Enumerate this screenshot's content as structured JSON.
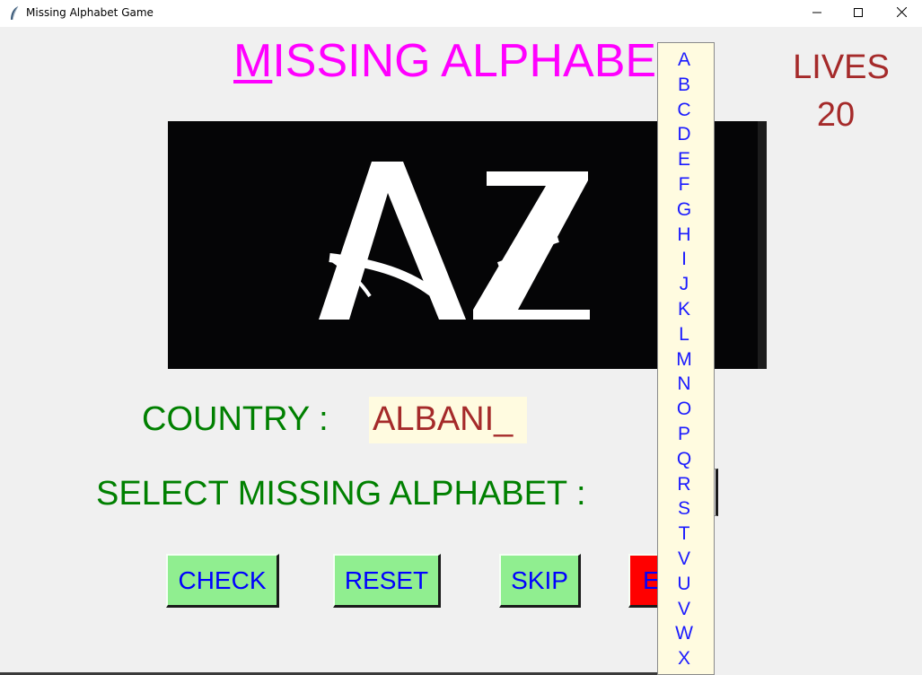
{
  "window": {
    "title": "Missing Alphabet Game"
  },
  "heading": {
    "first_letter": "M",
    "rest": "ISSING ALPHABE"
  },
  "lives": {
    "label": "LIVES",
    "value": "20"
  },
  "picture": {
    "text": "AZ"
  },
  "country": {
    "label": "COUNTRY :",
    "value": "ALBANI_"
  },
  "select": {
    "label": "SELECT MISSING ALPHABET :"
  },
  "buttons": {
    "check": "CHECK",
    "reset": "RESET",
    "skip": "SKIP",
    "exit": "E"
  },
  "dropdown": {
    "options": [
      "A",
      "B",
      "C",
      "D",
      "E",
      "F",
      "G",
      "H",
      "I",
      "J",
      "K",
      "L",
      "M",
      "N",
      "O",
      "P",
      "Q",
      "R",
      "S",
      "T",
      "V",
      "U",
      "V",
      "W",
      "X"
    ]
  },
  "colors": {
    "heading": "#ff00ff",
    "lives": "#a52a2a",
    "label_green": "#008000",
    "button_green": "#90ee90",
    "button_exit": "#ff0000",
    "button_text": "#0000ff",
    "dropdown_bg": "#fffbe0"
  },
  "icons": {
    "app": "feather-icon",
    "minimize": "minimize-icon",
    "maximize": "maximize-icon",
    "close": "close-icon"
  }
}
